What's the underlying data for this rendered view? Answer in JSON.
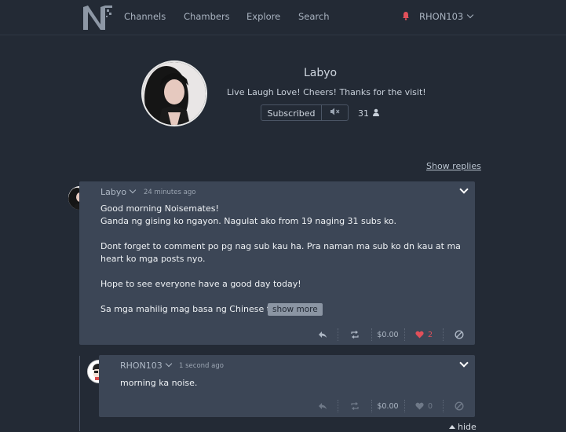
{
  "nav": {
    "logo_text": "N",
    "links": [
      "Channels",
      "Chambers",
      "Explore",
      "Search"
    ],
    "user": "RHON103"
  },
  "profile": {
    "name": "Labyo",
    "bio": "Live Laugh Love! Cheers! Thanks for the visit!",
    "subscribe_label": "Subscribed",
    "mute_label": "◀×",
    "subscriber_count": "31"
  },
  "show_replies": "Show replies",
  "post": {
    "author": "Labyo",
    "time": "24 minutes ago",
    "body": "Good morning Noisemates!\nGanda ng gising ko ngayon. Nagulat ako from 19 naging 31 subs ko.\n\nDont forget to comment po pg nag sub kau ha. Pra naman ma sub ko dn kau at ma heart ko mga posts nyo.\n\nHope to see everyone have a good day today!\n\nSa mga mahilig mag basa ng Chinese tra...",
    "show_more": "show more",
    "tip": "$0.00",
    "likes": "2"
  },
  "reply": {
    "author": "RHON103",
    "time": "1 second ago",
    "body": "morning ka noise.",
    "tip": "$0.00",
    "likes": "0"
  },
  "hide_label": "hide",
  "colors": {
    "background": "#232a35",
    "card": "#3c4656",
    "accent_red": "#e2505a"
  }
}
